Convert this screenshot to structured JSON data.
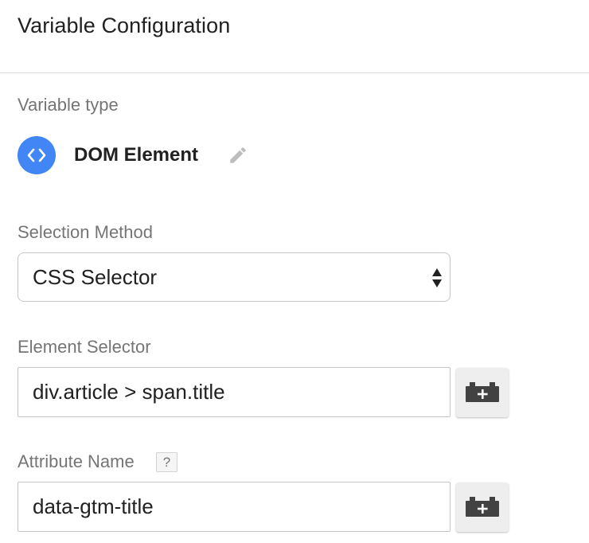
{
  "header": {
    "title": "Variable Configuration"
  },
  "variable_type": {
    "label": "Variable type",
    "name": "DOM Element",
    "icon": "code-brackets-icon",
    "icon_color": "#4285f4"
  },
  "selection_method": {
    "label": "Selection Method",
    "value": "CSS Selector"
  },
  "element_selector": {
    "label": "Element Selector",
    "value": "div.article > span.title"
  },
  "attribute_name": {
    "label": "Attribute Name",
    "help": "?",
    "value": "data-gtm-title"
  }
}
